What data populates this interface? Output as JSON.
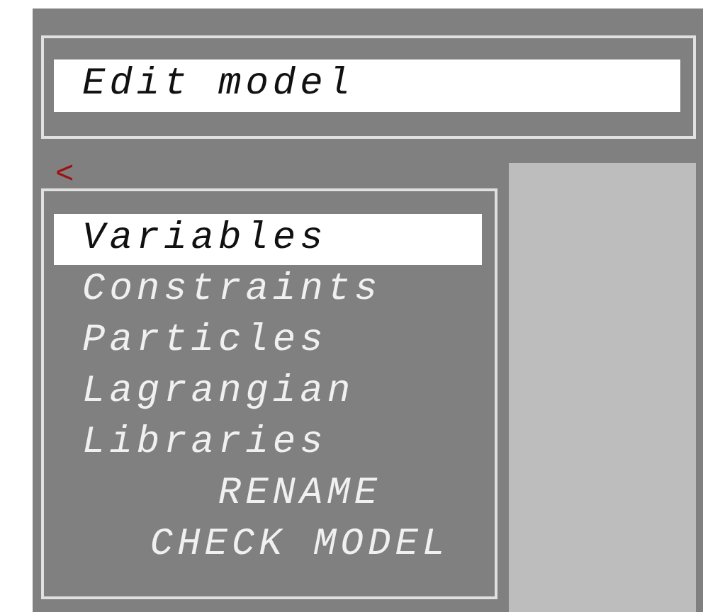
{
  "title_field": {
    "value": "Edit model"
  },
  "back_button": {
    "label": "<"
  },
  "menu": {
    "items": [
      {
        "label": "Variables",
        "kind": "category",
        "selected": true
      },
      {
        "label": "Constraints",
        "kind": "category",
        "selected": false
      },
      {
        "label": "Particles",
        "kind": "category",
        "selected": false
      },
      {
        "label": "Lagrangian",
        "kind": "category",
        "selected": false
      },
      {
        "label": "Libraries",
        "kind": "category",
        "selected": false
      },
      {
        "label": "RENAME",
        "kind": "action",
        "selected": false
      },
      {
        "label": "CHECK MODEL",
        "kind": "action",
        "selected": false
      }
    ]
  }
}
